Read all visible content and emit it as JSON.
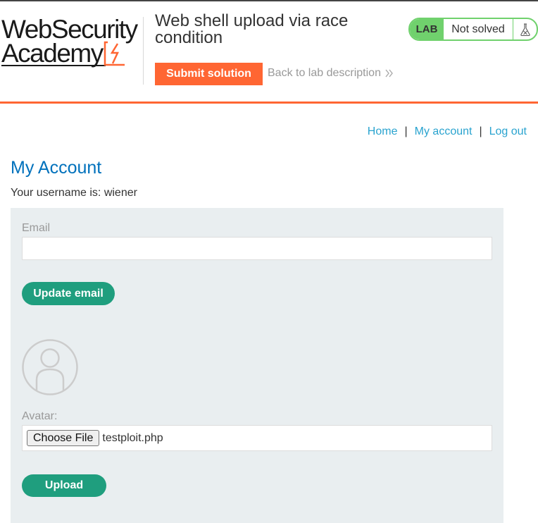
{
  "header": {
    "logo_line1": "WebSecurity",
    "logo_line2": "Academy",
    "lab_title": "Web shell upload via race condition",
    "submit_label": "Submit solution",
    "back_label": "Back to lab description",
    "back_icon": "double-chevron-right-icon",
    "status_tag": "LAB",
    "status_text": "Not solved",
    "status_icon": "flask-icon"
  },
  "nav": {
    "home": "Home",
    "my_account": "My account",
    "logout": "Log out",
    "separator": "|"
  },
  "page": {
    "title": "My Account",
    "username_text": "Your username is: wiener"
  },
  "form": {
    "email_label": "Email",
    "email_value": "",
    "update_email_label": "Update email",
    "avatar_label": "Avatar:",
    "choose_file_label": "Choose File",
    "file_name": "testploit.php",
    "upload_label": "Upload"
  },
  "colors": {
    "accent_orange": "#ff6633",
    "link_blue": "#29a3cf",
    "title_blue": "#0071bc",
    "button_green": "#1f9e7e",
    "lab_green": "#70d16d",
    "panel_bg": "#e9eef0"
  }
}
